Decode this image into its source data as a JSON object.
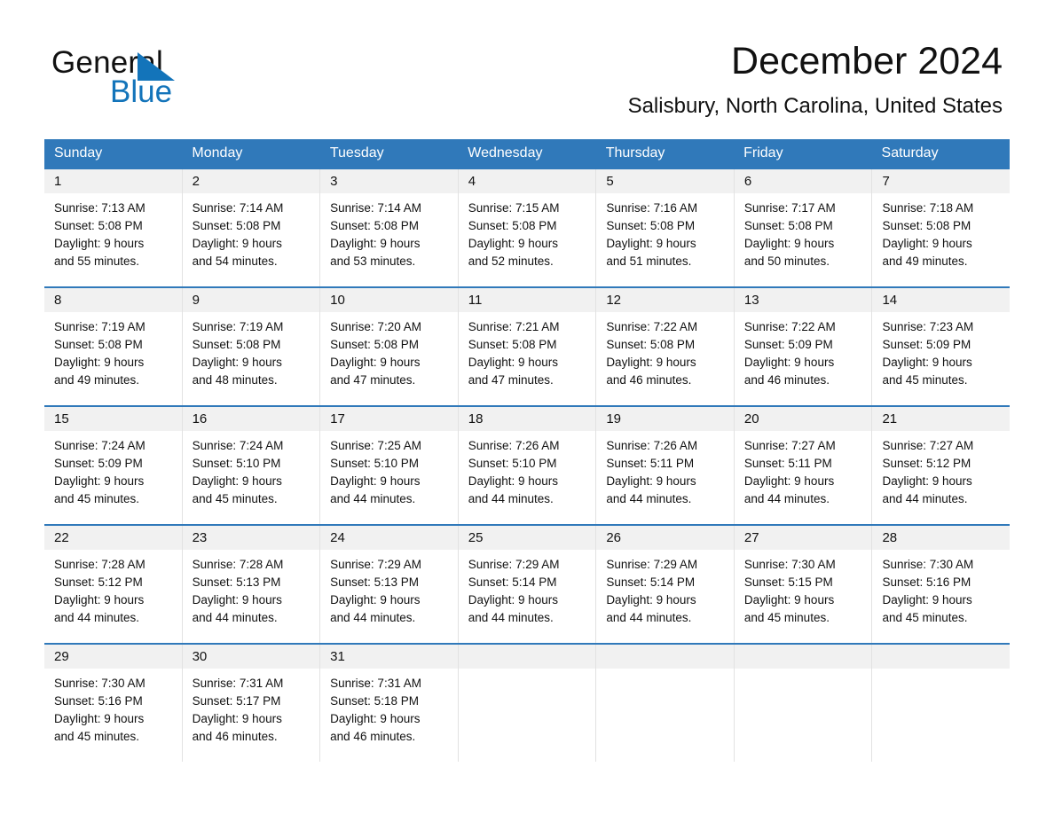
{
  "brand": {
    "name_part1": "General",
    "name_part2": "Blue",
    "triangle_icon": "blue-triangle-icon",
    "colors": {
      "accent": "#1374ba",
      "header": "#3079ba",
      "band": "#f1f1f1"
    }
  },
  "header": {
    "title": "December 2024",
    "subtitle": "Salisbury, North Carolina, United States"
  },
  "weekdays": [
    "Sunday",
    "Monday",
    "Tuesday",
    "Wednesday",
    "Thursday",
    "Friday",
    "Saturday"
  ],
  "weeks": [
    [
      {
        "day": "1",
        "sunrise": "Sunrise: 7:13 AM",
        "sunset": "Sunset: 5:08 PM",
        "daylight1": "Daylight: 9 hours",
        "daylight2": "and 55 minutes."
      },
      {
        "day": "2",
        "sunrise": "Sunrise: 7:14 AM",
        "sunset": "Sunset: 5:08 PM",
        "daylight1": "Daylight: 9 hours",
        "daylight2": "and 54 minutes."
      },
      {
        "day": "3",
        "sunrise": "Sunrise: 7:14 AM",
        "sunset": "Sunset: 5:08 PM",
        "daylight1": "Daylight: 9 hours",
        "daylight2": "and 53 minutes."
      },
      {
        "day": "4",
        "sunrise": "Sunrise: 7:15 AM",
        "sunset": "Sunset: 5:08 PM",
        "daylight1": "Daylight: 9 hours",
        "daylight2": "and 52 minutes."
      },
      {
        "day": "5",
        "sunrise": "Sunrise: 7:16 AM",
        "sunset": "Sunset: 5:08 PM",
        "daylight1": "Daylight: 9 hours",
        "daylight2": "and 51 minutes."
      },
      {
        "day": "6",
        "sunrise": "Sunrise: 7:17 AM",
        "sunset": "Sunset: 5:08 PM",
        "daylight1": "Daylight: 9 hours",
        "daylight2": "and 50 minutes."
      },
      {
        "day": "7",
        "sunrise": "Sunrise: 7:18 AM",
        "sunset": "Sunset: 5:08 PM",
        "daylight1": "Daylight: 9 hours",
        "daylight2": "and 49 minutes."
      }
    ],
    [
      {
        "day": "8",
        "sunrise": "Sunrise: 7:19 AM",
        "sunset": "Sunset: 5:08 PM",
        "daylight1": "Daylight: 9 hours",
        "daylight2": "and 49 minutes."
      },
      {
        "day": "9",
        "sunrise": "Sunrise: 7:19 AM",
        "sunset": "Sunset: 5:08 PM",
        "daylight1": "Daylight: 9 hours",
        "daylight2": "and 48 minutes."
      },
      {
        "day": "10",
        "sunrise": "Sunrise: 7:20 AM",
        "sunset": "Sunset: 5:08 PM",
        "daylight1": "Daylight: 9 hours",
        "daylight2": "and 47 minutes."
      },
      {
        "day": "11",
        "sunrise": "Sunrise: 7:21 AM",
        "sunset": "Sunset: 5:08 PM",
        "daylight1": "Daylight: 9 hours",
        "daylight2": "and 47 minutes."
      },
      {
        "day": "12",
        "sunrise": "Sunrise: 7:22 AM",
        "sunset": "Sunset: 5:08 PM",
        "daylight1": "Daylight: 9 hours",
        "daylight2": "and 46 minutes."
      },
      {
        "day": "13",
        "sunrise": "Sunrise: 7:22 AM",
        "sunset": "Sunset: 5:09 PM",
        "daylight1": "Daylight: 9 hours",
        "daylight2": "and 46 minutes."
      },
      {
        "day": "14",
        "sunrise": "Sunrise: 7:23 AM",
        "sunset": "Sunset: 5:09 PM",
        "daylight1": "Daylight: 9 hours",
        "daylight2": "and 45 minutes."
      }
    ],
    [
      {
        "day": "15",
        "sunrise": "Sunrise: 7:24 AM",
        "sunset": "Sunset: 5:09 PM",
        "daylight1": "Daylight: 9 hours",
        "daylight2": "and 45 minutes."
      },
      {
        "day": "16",
        "sunrise": "Sunrise: 7:24 AM",
        "sunset": "Sunset: 5:10 PM",
        "daylight1": "Daylight: 9 hours",
        "daylight2": "and 45 minutes."
      },
      {
        "day": "17",
        "sunrise": "Sunrise: 7:25 AM",
        "sunset": "Sunset: 5:10 PM",
        "daylight1": "Daylight: 9 hours",
        "daylight2": "and 44 minutes."
      },
      {
        "day": "18",
        "sunrise": "Sunrise: 7:26 AM",
        "sunset": "Sunset: 5:10 PM",
        "daylight1": "Daylight: 9 hours",
        "daylight2": "and 44 minutes."
      },
      {
        "day": "19",
        "sunrise": "Sunrise: 7:26 AM",
        "sunset": "Sunset: 5:11 PM",
        "daylight1": "Daylight: 9 hours",
        "daylight2": "and 44 minutes."
      },
      {
        "day": "20",
        "sunrise": "Sunrise: 7:27 AM",
        "sunset": "Sunset: 5:11 PM",
        "daylight1": "Daylight: 9 hours",
        "daylight2": "and 44 minutes."
      },
      {
        "day": "21",
        "sunrise": "Sunrise: 7:27 AM",
        "sunset": "Sunset: 5:12 PM",
        "daylight1": "Daylight: 9 hours",
        "daylight2": "and 44 minutes."
      }
    ],
    [
      {
        "day": "22",
        "sunrise": "Sunrise: 7:28 AM",
        "sunset": "Sunset: 5:12 PM",
        "daylight1": "Daylight: 9 hours",
        "daylight2": "and 44 minutes."
      },
      {
        "day": "23",
        "sunrise": "Sunrise: 7:28 AM",
        "sunset": "Sunset: 5:13 PM",
        "daylight1": "Daylight: 9 hours",
        "daylight2": "and 44 minutes."
      },
      {
        "day": "24",
        "sunrise": "Sunrise: 7:29 AM",
        "sunset": "Sunset: 5:13 PM",
        "daylight1": "Daylight: 9 hours",
        "daylight2": "and 44 minutes."
      },
      {
        "day": "25",
        "sunrise": "Sunrise: 7:29 AM",
        "sunset": "Sunset: 5:14 PM",
        "daylight1": "Daylight: 9 hours",
        "daylight2": "and 44 minutes."
      },
      {
        "day": "26",
        "sunrise": "Sunrise: 7:29 AM",
        "sunset": "Sunset: 5:14 PM",
        "daylight1": "Daylight: 9 hours",
        "daylight2": "and 44 minutes."
      },
      {
        "day": "27",
        "sunrise": "Sunrise: 7:30 AM",
        "sunset": "Sunset: 5:15 PM",
        "daylight1": "Daylight: 9 hours",
        "daylight2": "and 45 minutes."
      },
      {
        "day": "28",
        "sunrise": "Sunrise: 7:30 AM",
        "sunset": "Sunset: 5:16 PM",
        "daylight1": "Daylight: 9 hours",
        "daylight2": "and 45 minutes."
      }
    ],
    [
      {
        "day": "29",
        "sunrise": "Sunrise: 7:30 AM",
        "sunset": "Sunset: 5:16 PM",
        "daylight1": "Daylight: 9 hours",
        "daylight2": "and 45 minutes."
      },
      {
        "day": "30",
        "sunrise": "Sunrise: 7:31 AM",
        "sunset": "Sunset: 5:17 PM",
        "daylight1": "Daylight: 9 hours",
        "daylight2": "and 46 minutes."
      },
      {
        "day": "31",
        "sunrise": "Sunrise: 7:31 AM",
        "sunset": "Sunset: 5:18 PM",
        "daylight1": "Daylight: 9 hours",
        "daylight2": "and 46 minutes."
      },
      {
        "day": "",
        "sunrise": "",
        "sunset": "",
        "daylight1": "",
        "daylight2": ""
      },
      {
        "day": "",
        "sunrise": "",
        "sunset": "",
        "daylight1": "",
        "daylight2": ""
      },
      {
        "day": "",
        "sunrise": "",
        "sunset": "",
        "daylight1": "",
        "daylight2": ""
      },
      {
        "day": "",
        "sunrise": "",
        "sunset": "",
        "daylight1": "",
        "daylight2": ""
      }
    ]
  ]
}
